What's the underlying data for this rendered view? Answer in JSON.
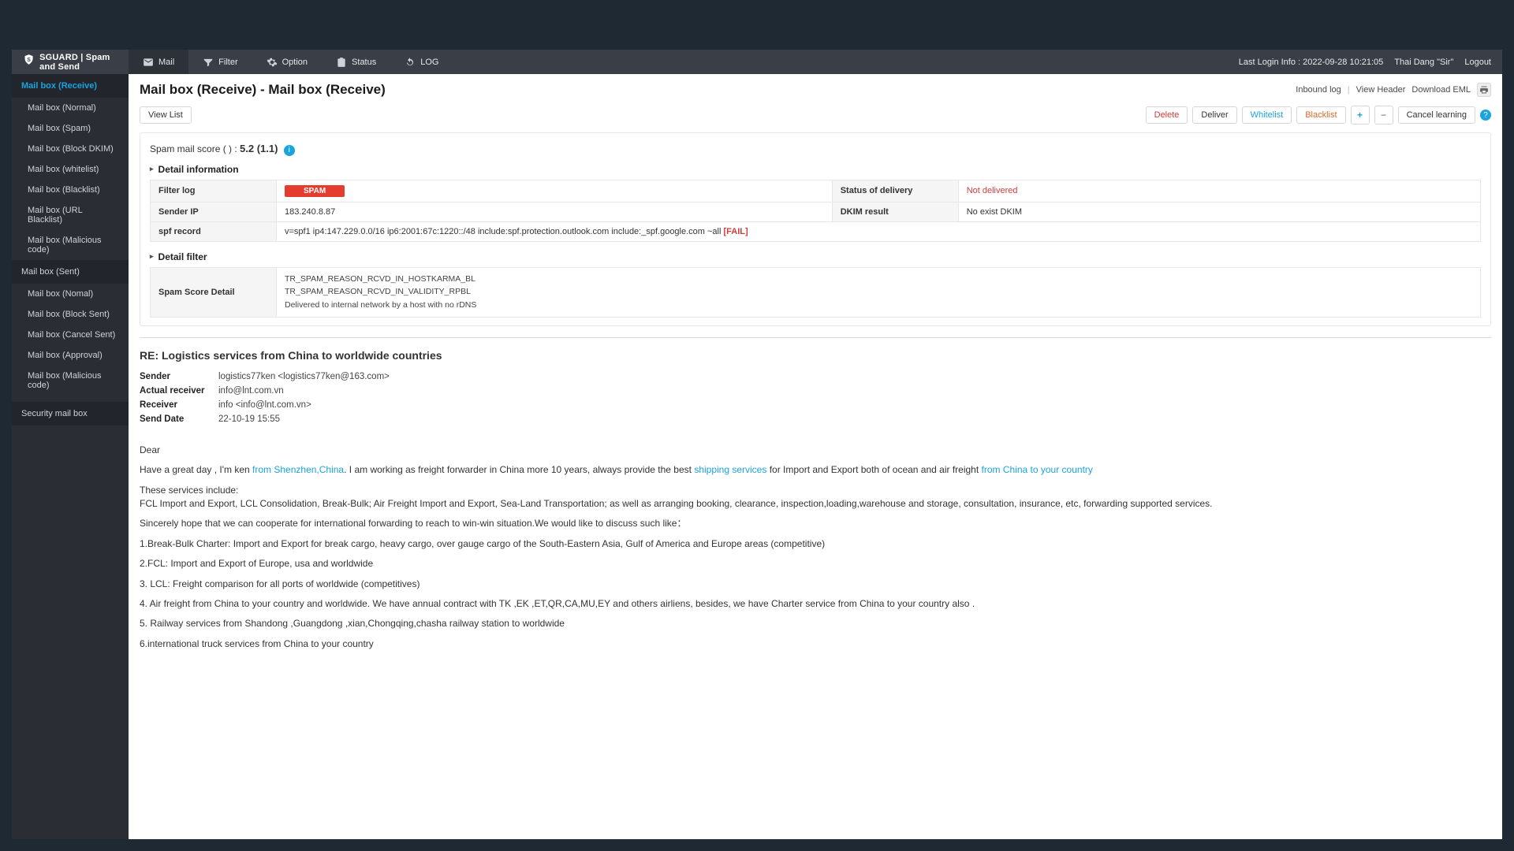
{
  "brand": {
    "name": "SGUARD | Spam and Send"
  },
  "nav": {
    "mail": "Mail",
    "filter": "Filter",
    "option": "Option",
    "status": "Status",
    "log": "LOG",
    "lastlogin": "Last Login Info : 2022-09-28 10:21:05",
    "user": "Thai Dang \"Sir\"",
    "logout": "Logout"
  },
  "sidebar": {
    "receive_header": "Mail box (Receive)",
    "receive_items": [
      "Mail box (Normal)",
      "Mail box (Spam)",
      "Mail box (Block DKIM)",
      "Mail box (whitelist)",
      "Mail box (Blacklist)",
      "Mail box (URL Blacklist)",
      "Mail box (Malicious code)"
    ],
    "sent_header": "Mail box (Sent)",
    "sent_items": [
      "Mail box (Nomal)",
      "Mail box (Block Sent)",
      "Mail box (Cancel Sent)",
      "Mail box (Approval)",
      "Mail box (Malicious code)"
    ],
    "security_header": "Security mail box"
  },
  "pagehead": {
    "title": "Mail box (Receive) - Mail box (Receive)",
    "inbound": "Inbound log",
    "viewheader": "View Header",
    "downloademl": "Download EML"
  },
  "toolbar": {
    "viewlist": "View List",
    "delete": "Delete",
    "deliver": "Deliver",
    "whitelist": "Whitelist",
    "blacklist": "Blacklist",
    "cancel": "Cancel learning"
  },
  "score": {
    "label_pre": "Spam mail score ( ) : ",
    "value": "5.2 (1.1)"
  },
  "sections": {
    "detail_info": "Detail information",
    "detail_filter": "Detail filter"
  },
  "table": {
    "filterlog": "Filter log",
    "spam": "SPAM",
    "status": "Status of delivery",
    "notdelivered": "Not delivered",
    "senderip_k": "Sender IP",
    "senderip_v": "183.240.8.87",
    "dkim_k": "DKIM result",
    "dkim_v": "No exist DKIM",
    "spf_k": "spf record",
    "spf_v": "v=spf1 ip4:147.229.0.0/16 ip6:2001:67c:1220::/48 include:spf.protection.outlook.com include:_spf.google.com ~all ",
    "spf_fail": "[FAIL]",
    "score_detail_k": "Spam Score Detail",
    "reasons": [
      "TR_SPAM_REASON_RCVD_IN_HOSTKARMA_BL",
      "TR_SPAM_REASON_RCVD_IN_VALIDITY_RPBL",
      "Delivered to internal network by a host with no rDNS"
    ]
  },
  "mail": {
    "subject": "RE: Logistics services from China to worldwide countries",
    "sender_k": "Sender",
    "sender_v": "logistics77ken <logistics77ken@163.com>",
    "actual_k": "Actual receiver",
    "actual_v": "info@lnt.com.vn",
    "receiver_k": "Receiver",
    "receiver_v": "info <info@lnt.com.vn>",
    "date_k": "Send Date",
    "date_v": "22-10-19 15:55",
    "body": {
      "greet": "Dear",
      "p1a": "Have a great day , I'm ken ",
      "p1b": "from Shenzhen,China",
      "p1c": ". I am working as freight forwarder in China more 10 years, always provide the best ",
      "p1d": "shipping services",
      "p1e": " for Import and Export both of ocean and air freight ",
      "p1f": "from China to your country",
      "p2": "These services include:",
      "p3": "FCL Import and Export, LCL Consolidation, Break-Bulk; Air Freight Import and Export, Sea-Land Transportation; as well as arranging booking, clearance, inspection,loading,warehouse and storage, consultation, insurance, etc, forwarding supported services.",
      "p4": "Sincerely hope that we can cooperate for international forwarding to reach to win-win situation.We would like to discuss such like：",
      "p5": "1.Break-Bulk Charter: Import and Export for break cargo, heavy cargo, over gauge cargo of the South-Eastern Asia, Gulf of America and Europe areas (competitive)",
      "p6": "2.FCL: Import and Export of Europe, usa and worldwide",
      "p7": "3. LCL: Freight comparison for all ports of worldwide (competitives)",
      "p8": "4.  Air freight from China to your country and worldwide. We have annual contract with TK ,EK ,ET,QR,CA,MU,EY and others airliens, besides, we have Charter service from China to your country also .",
      "p9": "5. Railway services from Shandong ,Guangdong ,xian,Chongqing,chasha railway station to worldwide",
      "p10": "6.international truck services from China to your country"
    }
  }
}
